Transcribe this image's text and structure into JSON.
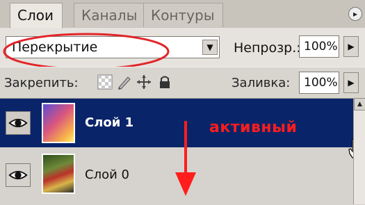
{
  "tabs": [
    {
      "label": "Слои",
      "active": true
    },
    {
      "label": "Каналы",
      "active": false
    },
    {
      "label": "Контуры",
      "active": false
    }
  ],
  "blend": {
    "value": "Перекрытие"
  },
  "opacity": {
    "label": "Непрозр.:",
    "value": "100%"
  },
  "lock": {
    "label": "Закрепить:"
  },
  "fill": {
    "label": "Заливка:",
    "value": "100%"
  },
  "layers": [
    {
      "name": "Слой 1",
      "selected": true
    },
    {
      "name": "Слой 0",
      "selected": false
    }
  ],
  "annotation": {
    "text": "активный"
  },
  "colors": {
    "selection": "#0a246a",
    "annotation_red": "#ff1d1d",
    "panel_bg": "#d6d3ce"
  },
  "icons": {
    "tab_menu": "circle-arrow-icon",
    "dropdown": "triangle-down-icon",
    "stepper": "triangle-right-icon",
    "visibility": "eye-icon",
    "cursor": "hand-cursor-icon"
  }
}
